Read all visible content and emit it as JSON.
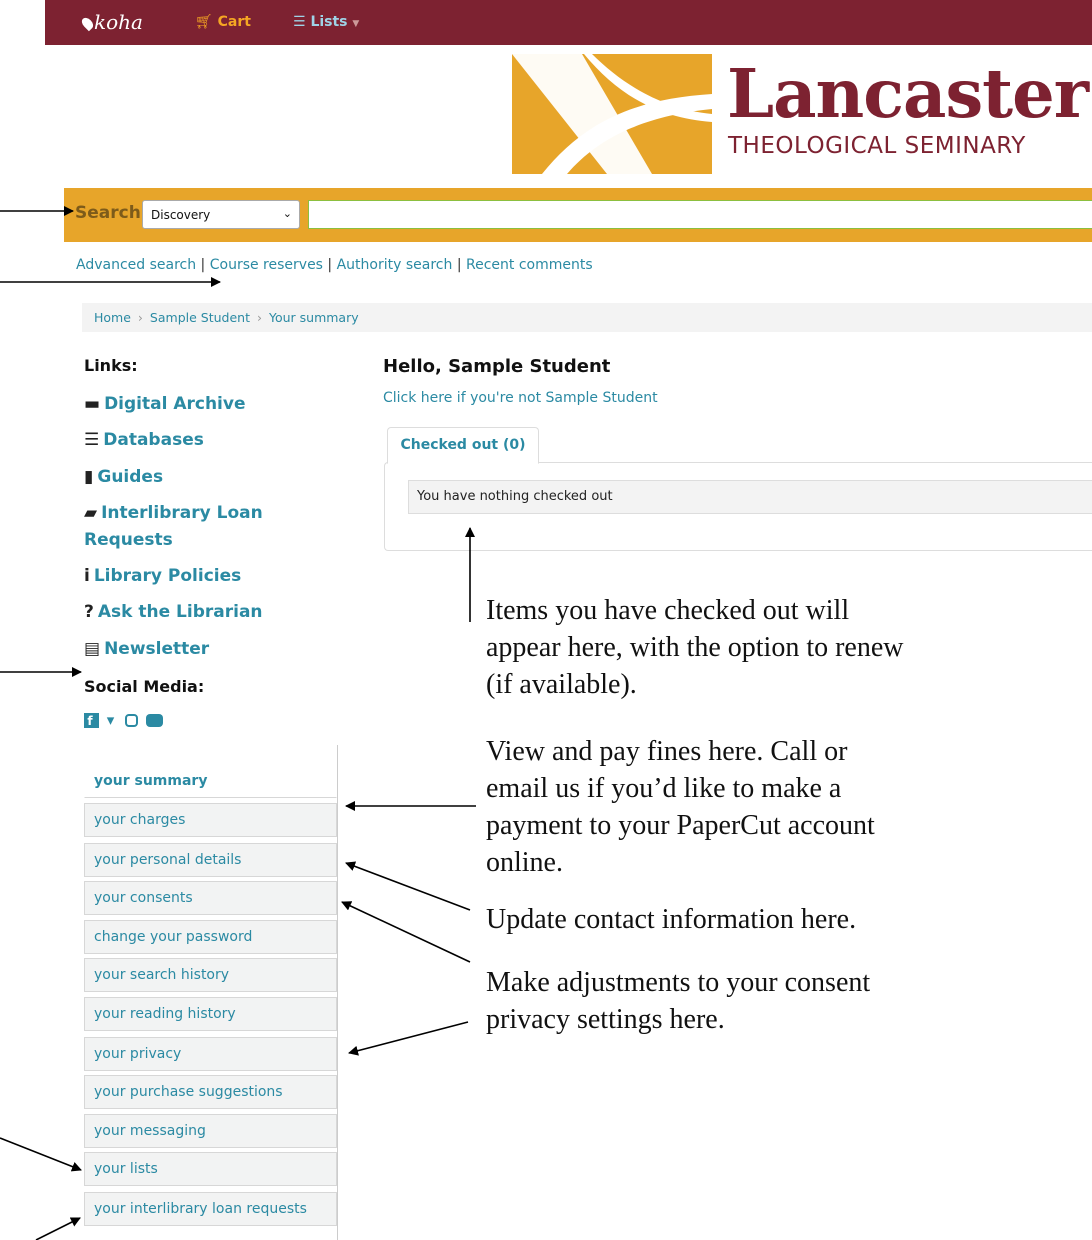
{
  "navbar": {
    "brand": "koha",
    "cart": "Cart",
    "lists": "Lists"
  },
  "logo": {
    "title": "Lancaster",
    "subtitle": "THEOLOGICAL SEMINARY"
  },
  "search": {
    "label": "Search",
    "selected_option": "Discovery",
    "query": ""
  },
  "more_searches": [
    "Advanced search",
    "Course reserves",
    "Authority search",
    "Recent comments"
  ],
  "breadcrumb": [
    "Home",
    "Sample Student",
    "Your summary"
  ],
  "sidebar": {
    "links_heading": "Links:",
    "links": [
      {
        "icon": "archive-icon",
        "glyph": "▬",
        "label": "Digital Archive"
      },
      {
        "icon": "database-icon",
        "glyph": "☰",
        "label": "Databases"
      },
      {
        "icon": "bookmark-icon",
        "glyph": "▮",
        "label": "Guides"
      },
      {
        "icon": "book-icon",
        "glyph": "▰",
        "label": "Interlibrary Loan",
        "label2": "Requests"
      },
      {
        "icon": "info-icon",
        "glyph": "i",
        "label": "Library Policies"
      },
      {
        "icon": "question-icon",
        "glyph": "?",
        "label": "Ask the Librarian"
      },
      {
        "icon": "newspaper-icon",
        "glyph": "▤",
        "label": "Newsletter"
      }
    ],
    "social_heading": "Social Media:",
    "social_icons": [
      "facebook-icon",
      "twitter-icon",
      "instagram-icon",
      "youtube-icon"
    ]
  },
  "user_menu": [
    "your summary",
    "your charges",
    "your personal details",
    "your consents",
    "change your password",
    "your search history",
    "your reading history",
    "your privacy",
    "your purchase suggestions",
    "your messaging",
    "your lists",
    "your interlibrary loan requests"
  ],
  "main": {
    "greeting": "Hello, Sample Student",
    "not_me_link": "Click here if you're not Sample Student",
    "tab_label": "Checked out (0)",
    "empty_message": "You have nothing checked out"
  },
  "annotations": {
    "checked_out": [
      "Items you have checked out will",
      "appear here, with the option to renew",
      "(if available)."
    ],
    "charges": [
      "View and pay fines here. Call or",
      "email us if you’d like to make a",
      "payment to your PaperCut account",
      "online."
    ],
    "contact": [
      "Update contact information here."
    ],
    "consent": [
      "Make adjustments to your consent",
      "privacy settings here."
    ]
  },
  "colors": {
    "navbar": "#7d2231",
    "accent_gold": "#e7a52a",
    "link": "#2b8aa3"
  }
}
